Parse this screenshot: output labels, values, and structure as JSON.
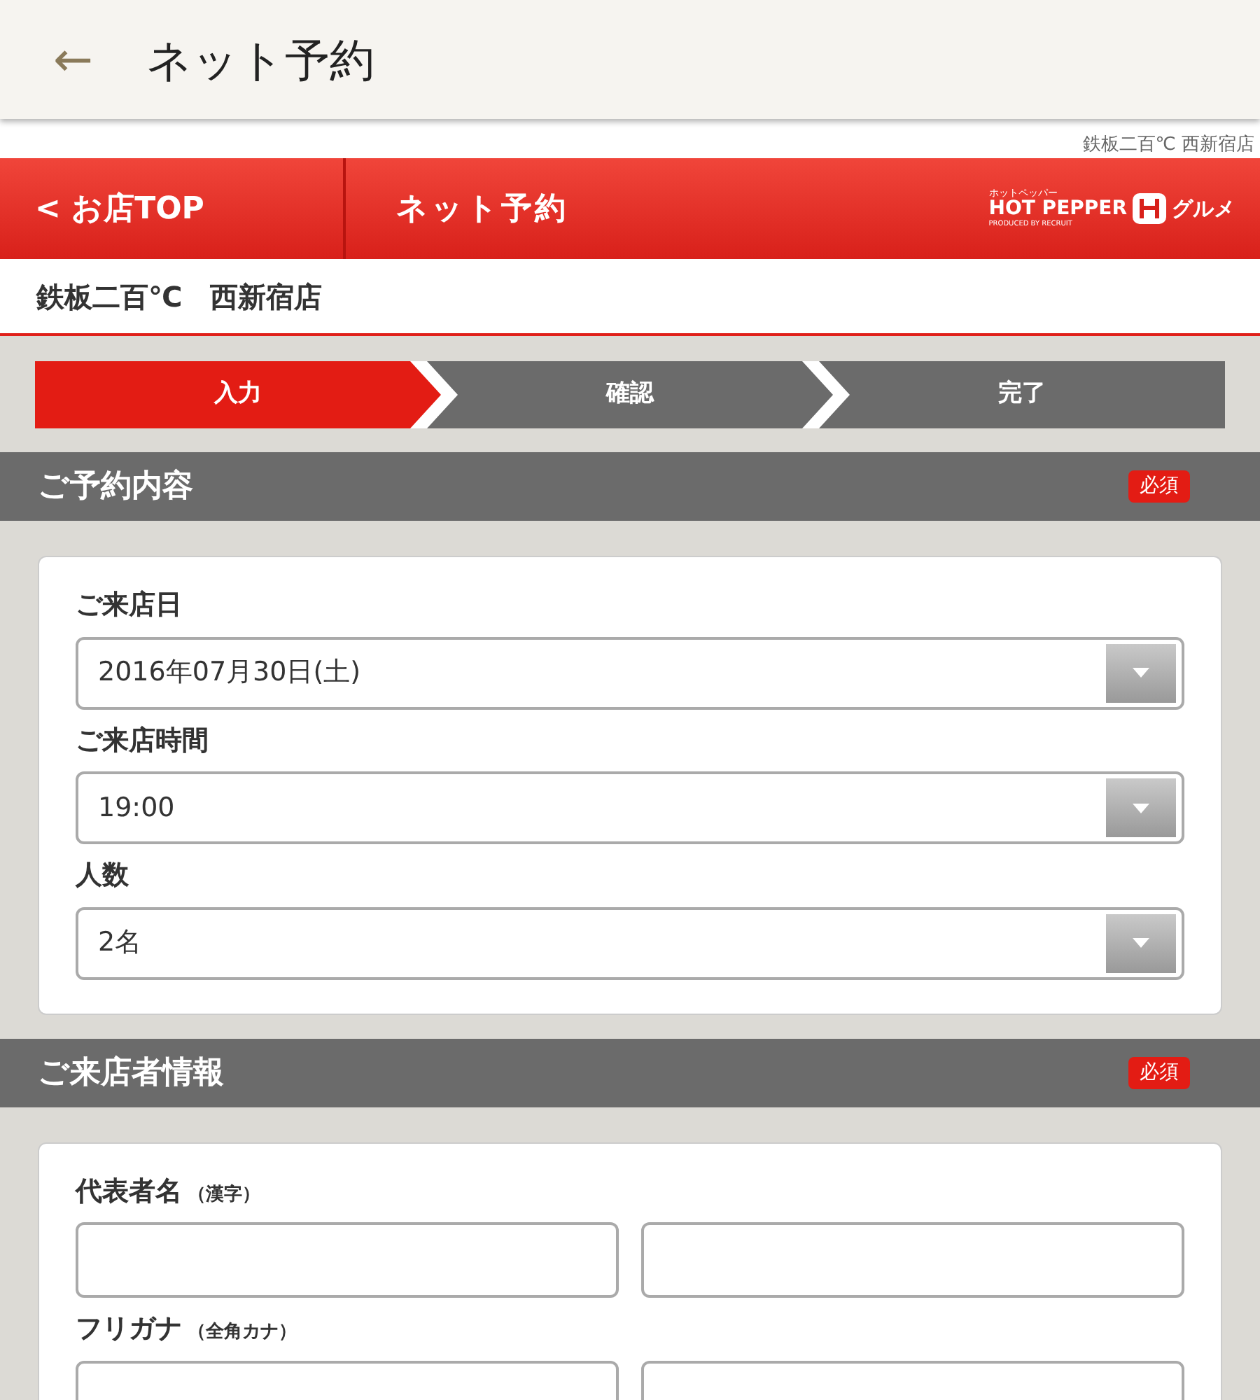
{
  "app_bar": {
    "back": "←",
    "title": "ネット予約"
  },
  "shop_caption": "鉄板二百℃ 西新宿店",
  "header": {
    "back_link": "< お店TOP",
    "title": "ネット予約",
    "logo": {
      "kana": "ホットペッパー",
      "brand": "HOT PEPPER",
      "brand_suffix": "グルメ",
      "produced_by": "PRODUCED BY RECRUIT"
    }
  },
  "shop_name": "鉄板二百℃　西新宿店",
  "steps": [
    {
      "label": "入力",
      "selected": true
    },
    {
      "label": "確認",
      "selected": false
    },
    {
      "label": "完了",
      "selected": false
    }
  ],
  "sections": [
    {
      "title": "ご予約内容",
      "badge": "必須",
      "fields": [
        {
          "kind": "select",
          "label": "ご来店日",
          "value": "2016年07月30日(土)"
        },
        {
          "kind": "select",
          "label": "ご来店時間",
          "value": "19:00"
        },
        {
          "kind": "select",
          "label": "人数",
          "value": "2名"
        }
      ]
    },
    {
      "title": "ご来店者情報",
      "badge": "必須",
      "fields": [
        {
          "kind": "pair",
          "label": "代表者名",
          "note": "（漢字）"
        },
        {
          "kind": "pair",
          "label": "フリガナ",
          "note": "（全角カナ）"
        }
      ]
    }
  ]
}
